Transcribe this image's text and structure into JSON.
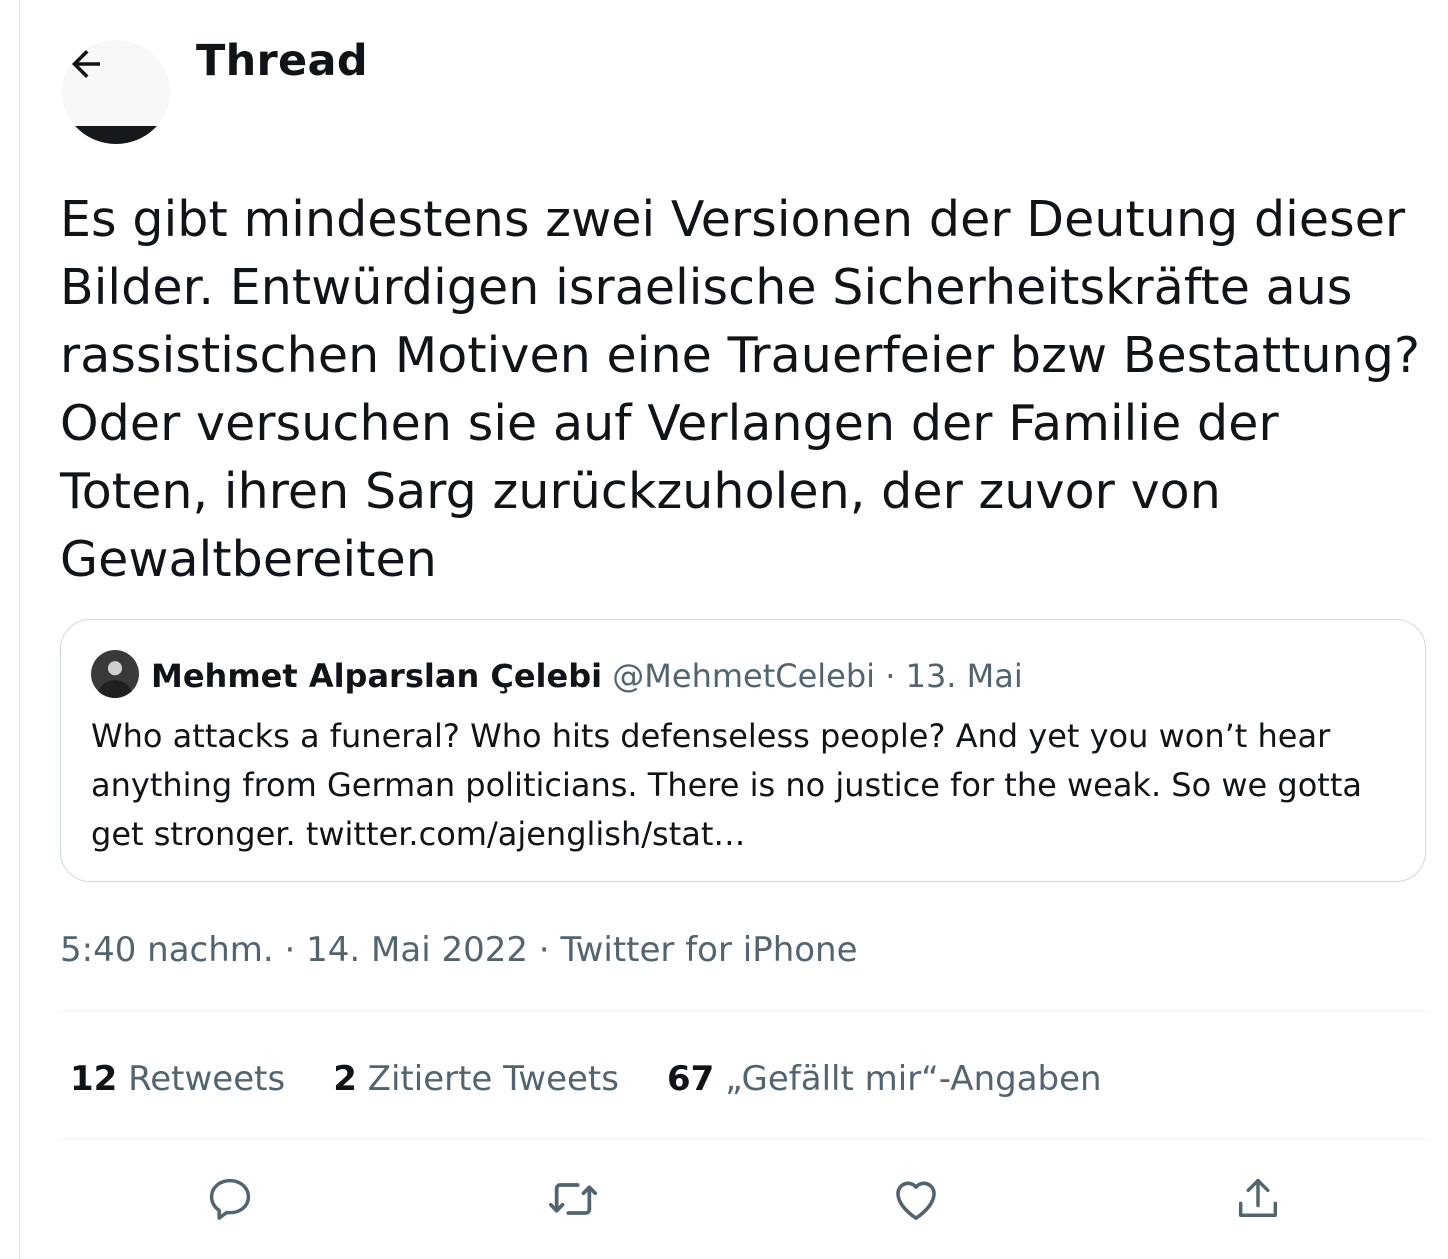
{
  "header": {
    "title": "Thread"
  },
  "tweet": {
    "text": "Es gibt mindestens zwei Versionen der Deutung dieser Bilder. Entwürdigen israelische Sicherheitskräfte aus rassistischen Motiven eine Trauerfeier bzw Bestattung? Oder versuchen sie auf Verlangen der Familie der Toten, ihren Sarg zurückzuholen, der zuvor von Gewaltbereiten",
    "meta": {
      "time": "5:40 nachm.",
      "separator1": " · ",
      "date": "14. Mai 2022",
      "separator2": " · ",
      "source": "Twitter for iPhone"
    }
  },
  "quote": {
    "name": "Mehmet Alparslan Çelebi",
    "handle": "@MehmetCelebi",
    "separator": "·",
    "date": "13. Mai",
    "text": "Who attacks a funeral? Who hits defenseless people? And yet you won’t hear anything from German politicians. There is no justice for the weak. So we gotta get stronger. twitter.com/ajenglish/stat…"
  },
  "stats": {
    "retweets_count": "12",
    "retweets_label": "Retweets",
    "quotes_count": "2",
    "quotes_label": "Zitierte Tweets",
    "likes_count": "67",
    "likes_label": "„Gefällt mir“-Angaben"
  },
  "actions": {
    "icons": [
      "reply-icon",
      "retweet-icon",
      "like-icon",
      "share-icon"
    ]
  },
  "colors": {
    "text_primary": "#0f1419",
    "text_secondary": "#536471",
    "border": "#cfd9de",
    "divider": "#eff3f4"
  }
}
